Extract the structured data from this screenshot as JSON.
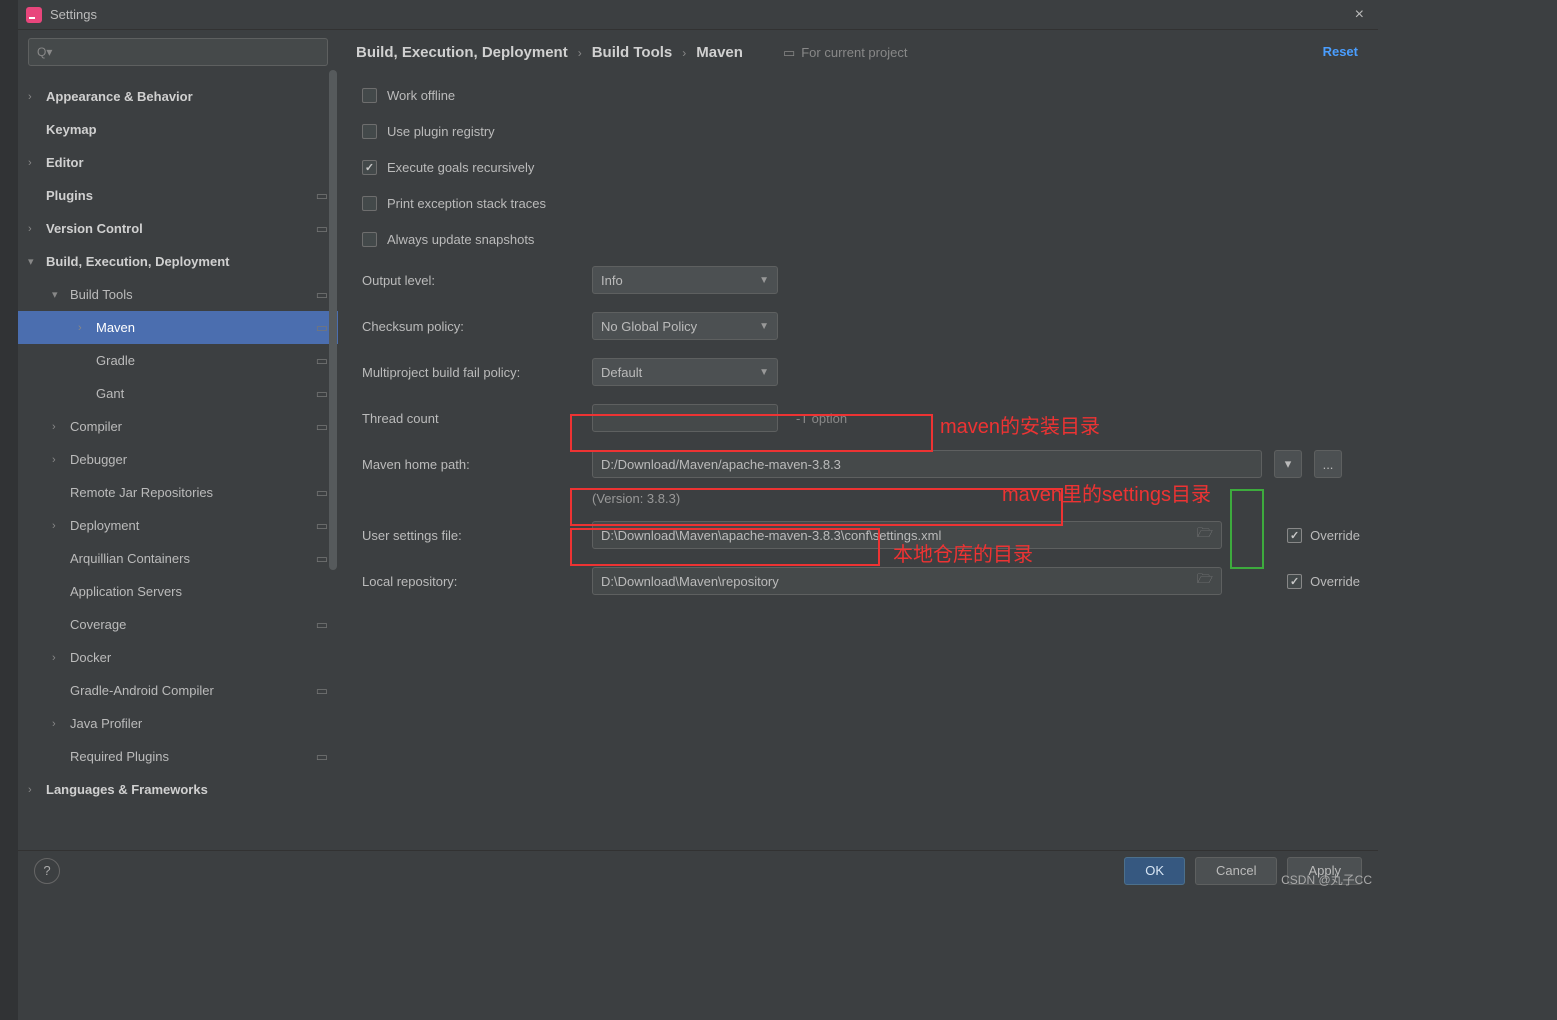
{
  "title": "Settings",
  "search_placeholder": "",
  "sidebar": [
    {
      "label": "Appearance & Behavior",
      "level": 0,
      "chev": ">",
      "bold": true,
      "copy": false
    },
    {
      "label": "Keymap",
      "level": 0,
      "chev": "",
      "bold": true,
      "copy": false
    },
    {
      "label": "Editor",
      "level": 0,
      "chev": ">",
      "bold": true,
      "copy": false
    },
    {
      "label": "Plugins",
      "level": 0,
      "chev": "",
      "bold": true,
      "copy": true
    },
    {
      "label": "Version Control",
      "level": 0,
      "chev": ">",
      "bold": true,
      "copy": true
    },
    {
      "label": "Build, Execution, Deployment",
      "level": 0,
      "chev": "v",
      "bold": true,
      "copy": false
    },
    {
      "label": "Build Tools",
      "level": 1,
      "chev": "v",
      "bold": false,
      "copy": true
    },
    {
      "label": "Maven",
      "level": 2,
      "chev": ">",
      "bold": false,
      "selected": true,
      "copy": true
    },
    {
      "label": "Gradle",
      "level": 2,
      "chev": "",
      "bold": false,
      "copy": true
    },
    {
      "label": "Gant",
      "level": 2,
      "chev": "",
      "bold": false,
      "copy": true
    },
    {
      "label": "Compiler",
      "level": 1,
      "chev": ">",
      "bold": false,
      "copy": true
    },
    {
      "label": "Debugger",
      "level": 1,
      "chev": ">",
      "bold": false,
      "copy": false
    },
    {
      "label": "Remote Jar Repositories",
      "level": 1,
      "chev": "",
      "bold": false,
      "copy": true
    },
    {
      "label": "Deployment",
      "level": 1,
      "chev": ">",
      "bold": false,
      "copy": true
    },
    {
      "label": "Arquillian Containers",
      "level": 1,
      "chev": "",
      "bold": false,
      "copy": true
    },
    {
      "label": "Application Servers",
      "level": 1,
      "chev": "",
      "bold": false,
      "copy": false
    },
    {
      "label": "Coverage",
      "level": 1,
      "chev": "",
      "bold": false,
      "copy": true
    },
    {
      "label": "Docker",
      "level": 1,
      "chev": ">",
      "bold": false,
      "copy": false
    },
    {
      "label": "Gradle-Android Compiler",
      "level": 1,
      "chev": "",
      "bold": false,
      "copy": true
    },
    {
      "label": "Java Profiler",
      "level": 1,
      "chev": ">",
      "bold": false,
      "copy": false
    },
    {
      "label": "Required Plugins",
      "level": 1,
      "chev": "",
      "bold": false,
      "copy": true
    },
    {
      "label": "Languages & Frameworks",
      "level": 0,
      "chev": ">",
      "bold": true,
      "copy": false
    }
  ],
  "breadcrumb": [
    "Build, Execution, Deployment",
    "Build Tools",
    "Maven"
  ],
  "for_project": "For current project",
  "reset_label": "Reset",
  "checkboxes": [
    {
      "label": "Work offline",
      "checked": false
    },
    {
      "label": "Use plugin registry",
      "checked": false
    },
    {
      "label": "Execute goals recursively",
      "checked": true
    },
    {
      "label": "Print exception stack traces",
      "checked": false
    },
    {
      "label": "Always update snapshots",
      "checked": false
    }
  ],
  "fields": {
    "output_level": {
      "label": "Output level:",
      "value": "Info"
    },
    "checksum": {
      "label": "Checksum policy:",
      "value": "No Global Policy"
    },
    "multiproject": {
      "label": "Multiproject build fail policy:",
      "value": "Default"
    },
    "thread_count": {
      "label": "Thread count",
      "value": "",
      "hint": "-T option"
    },
    "home_path": {
      "label": "Maven home path:",
      "value": "D:/Download/Maven/apache-maven-3.8.3"
    },
    "version_hint": "(Version: 3.8.3)",
    "user_settings": {
      "label": "User settings file:",
      "value": "D:\\Download\\Maven\\apache-maven-3.8.3\\conf\\settings.xml",
      "override": true
    },
    "local_repo": {
      "label": "Local repository:",
      "value": "D:\\Download\\Maven\\repository",
      "override": true
    }
  },
  "override_label": "Override",
  "annotations": {
    "a1": "maven的安装目录",
    "a2": "maven里的settings目录",
    "a3": "本地仓库的目录"
  },
  "footer": {
    "ok": "OK",
    "cancel": "Cancel",
    "apply": "Apply"
  },
  "watermark": "CSDN @丸子CC",
  "ellipsis": "..."
}
